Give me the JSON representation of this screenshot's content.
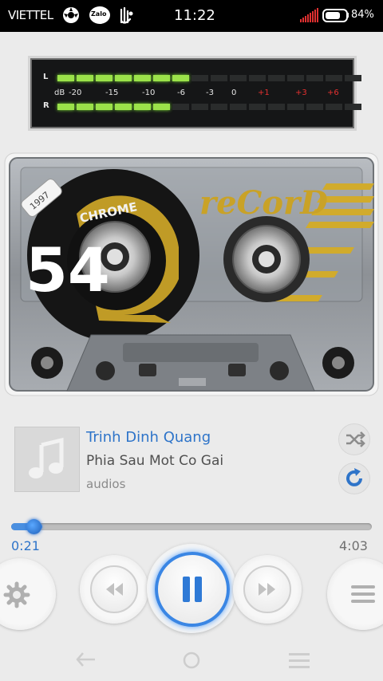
{
  "status_bar": {
    "carrier": "VIETTEL",
    "app_icons": [
      "ball-icon",
      "zalo-icon",
      "hand-icon"
    ],
    "zalo_label": "Zalo",
    "time": "11:22",
    "battery_percent": "84%",
    "battery_level": 0.84
  },
  "vu_meter": {
    "left_label": "L",
    "right_label": "R",
    "db_label": "dB",
    "scale": [
      "-20",
      "-15",
      "-10",
      "-6",
      "-3",
      "0",
      "+1",
      "+3",
      "+6"
    ],
    "left_level_segments": 7,
    "right_level_segments": 6,
    "total_segments": 16
  },
  "cassette": {
    "brand": "reCorD",
    "type_label": "CHROME",
    "length": "54",
    "year": "1997"
  },
  "track": {
    "artist": "Trinh Dinh Quang",
    "title": "Phia Sau Mot Co Gai",
    "album": "audios"
  },
  "playback": {
    "current_time": "0:21",
    "total_time": "4:03",
    "progress": 0.086,
    "state": "playing"
  },
  "icons": {
    "shuffle": "shuffle-icon",
    "repeat": "repeat-icon",
    "settings": "gear-icon",
    "previous": "rewind-icon",
    "pause": "pause-icon",
    "next": "fast-forward-icon",
    "menu": "menu-icon",
    "back": "back-icon",
    "home": "home-icon",
    "recents": "recents-icon"
  },
  "colors": {
    "accent": "#2e74c9",
    "vu_on": "#9be24a",
    "vu_red": "#e53030",
    "cassette_gold": "#c9a227"
  }
}
